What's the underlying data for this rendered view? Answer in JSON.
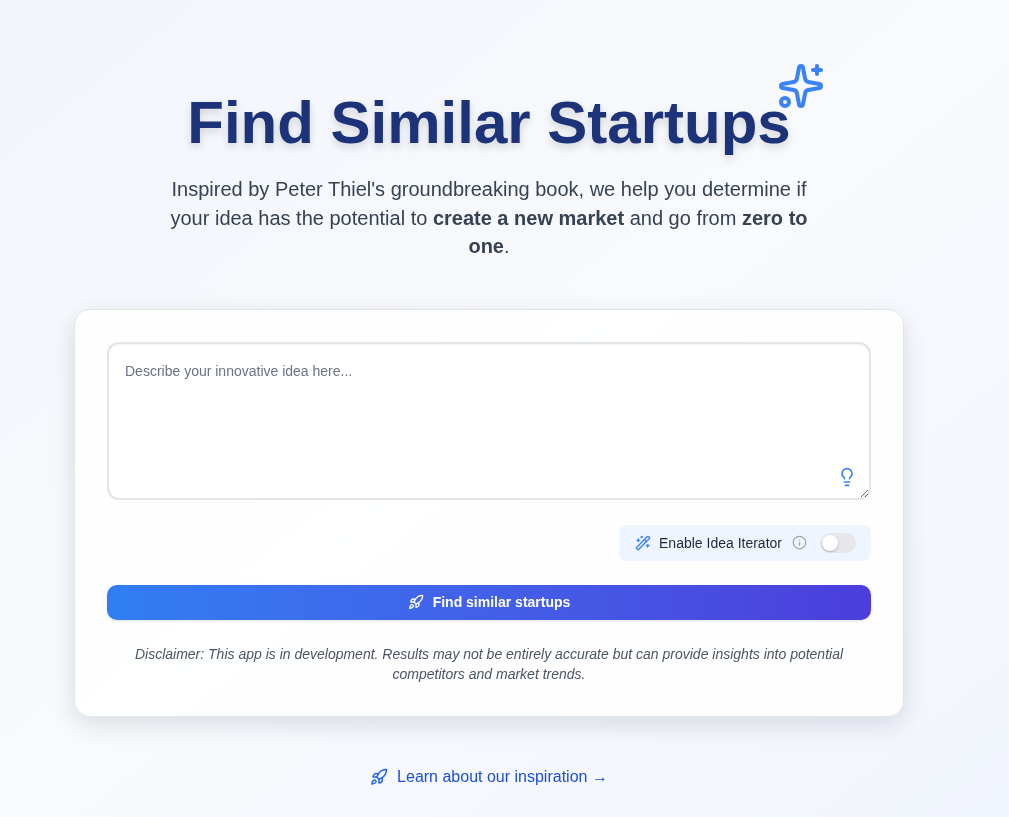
{
  "header": {
    "title": "Find Similar Startups",
    "subtitle": "Inspired by Peter Thiel's groundbreaking book, we help you determine if your idea has the potential to **create a new market** and go from **zero to one**."
  },
  "idea_form": {
    "idea_input": {
      "placeholder": "Describe your innovative idea here..."
    },
    "iterator_toggle": {
      "label": "Enable Idea Iterator",
      "on": false
    },
    "submit_button": {
      "label": "Find similar startups"
    },
    "disclaimer": "Disclaimer: This app is in development. Results may not be entirely accurate but can provide insights into potential competitors and market trends."
  },
  "footer_link": {
    "label": "Learn about our inspiration →"
  }
}
